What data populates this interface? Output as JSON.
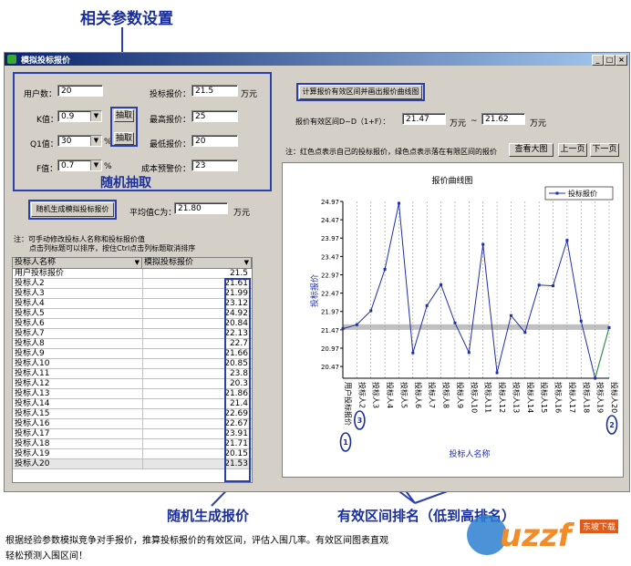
{
  "annotations": {
    "params_title": "相关参数设置",
    "random_pick": "随机抽取",
    "random_quote": "随机生成报价",
    "rank_note": "有效区间排名（低到高排名）"
  },
  "window": {
    "title": "模拟投标报价"
  },
  "params": {
    "users_label": "用户数：",
    "users_value": "20",
    "k_label": "K值：",
    "k_value": "0.9",
    "q1_label": "Q1值：",
    "q1_value": "30",
    "q1_unit": "%",
    "f_label": "F值：",
    "f_value": "0.7",
    "f_unit": "%",
    "pick_label": "抽取",
    "bid_label": "投标报价：",
    "bid_value": "21.5",
    "bid_unit": "万元",
    "max_label": "最高报价：",
    "max_value": "25",
    "min_label": "最低报价：",
    "min_value": "20",
    "warn_label": "成本预警价：",
    "warn_value": "23"
  },
  "generate_button": "随机生成模拟投标报价",
  "avg": {
    "label": "平均值C为：",
    "value": "21.80",
    "unit": "万元"
  },
  "hint": {
    "line1": "注：可手动修改投标人名称和投标报价值",
    "line2": "点击列标题可以排序，按住Ctrl点击列标题取消排序"
  },
  "grid": {
    "col1": "投标人名称",
    "col2": "模拟投标报价",
    "rows": [
      {
        "name": "用户投标报价",
        "value": "21.5"
      },
      {
        "name": "投标人2",
        "value": "21.61"
      },
      {
        "name": "投标人3",
        "value": "21.99"
      },
      {
        "name": "投标人4",
        "value": "23.12"
      },
      {
        "name": "投标人5",
        "value": "24.92"
      },
      {
        "name": "投标人6",
        "value": "20.84"
      },
      {
        "name": "投标人7",
        "value": "22.13"
      },
      {
        "name": "投标人8",
        "value": "22.7"
      },
      {
        "name": "投标人9",
        "value": "21.66"
      },
      {
        "name": "投标人10",
        "value": "20.85"
      },
      {
        "name": "投标人11",
        "value": "23.8"
      },
      {
        "name": "投标人12",
        "value": "20.3"
      },
      {
        "name": "投标人13",
        "value": "21.86"
      },
      {
        "name": "投标人14",
        "value": "21.4"
      },
      {
        "name": "投标人15",
        "value": "22.69"
      },
      {
        "name": "投标人16",
        "value": "22.67"
      },
      {
        "name": "投标人17",
        "value": "23.91"
      },
      {
        "name": "投标人18",
        "value": "21.71"
      },
      {
        "name": "投标人19",
        "value": "20.15"
      },
      {
        "name": "投标人20",
        "value": "21.53"
      }
    ]
  },
  "calc_button": "计算报价有效区间并画出报价曲线图",
  "range": {
    "label": "报价有效区间D~D（1+F）：",
    "low": "21.47",
    "unit1": "万元",
    "sep": "~",
    "high": "21.62",
    "unit2": "万元"
  },
  "note": "注：红色点表示自己的投标报价，绿色点表示落在有限区间的报价",
  "view_big": "查看大图",
  "prev_page": "上一页",
  "next_page": "下一页",
  "chart_data": {
    "type": "line",
    "title": "报价曲线图",
    "xlabel": "投标人名称",
    "ylabel": "投标报价",
    "legend": "投标报价",
    "legend_position": "top-right",
    "categories": [
      "用户投标报价",
      "投标人2",
      "投标人3",
      "投标人4",
      "投标人5",
      "投标人6",
      "投标人7",
      "投标人8",
      "投标人9",
      "投标人10",
      "投标人11",
      "投标人12",
      "投标人13",
      "投标人14",
      "投标人15",
      "投标人16",
      "投标人17",
      "投标人18",
      "投标人19",
      "投标人20"
    ],
    "values": [
      21.5,
      21.61,
      21.99,
      23.12,
      24.92,
      20.84,
      22.13,
      22.7,
      21.66,
      20.85,
      23.8,
      20.3,
      21.86,
      21.4,
      22.69,
      22.67,
      23.91,
      21.71,
      20.15,
      21.53
    ],
    "yticks": [
      "24.97",
      "24.47",
      "23.97",
      "23.47",
      "22.97",
      "22.47",
      "21.97",
      "21.47",
      "20.97",
      "20.47"
    ],
    "ylim": [
      20.15,
      24.97
    ],
    "band": [
      21.47,
      21.62
    ],
    "rank_labels": [
      "1",
      "3",
      "2"
    ],
    "colors": {
      "line": "#1f2fa8",
      "band": "#c0c0c0",
      "green": "#2e9e3a"
    }
  },
  "footer": {
    "line1": "根据经验参数模拟竞争对手报价，推算投标报价的有效区间，评估入围几率。有效区间图表直观",
    "line2": "轻松预测入围区间！"
  },
  "watermark": {
    "text": "uzzf",
    "sub": "东坡下载"
  }
}
